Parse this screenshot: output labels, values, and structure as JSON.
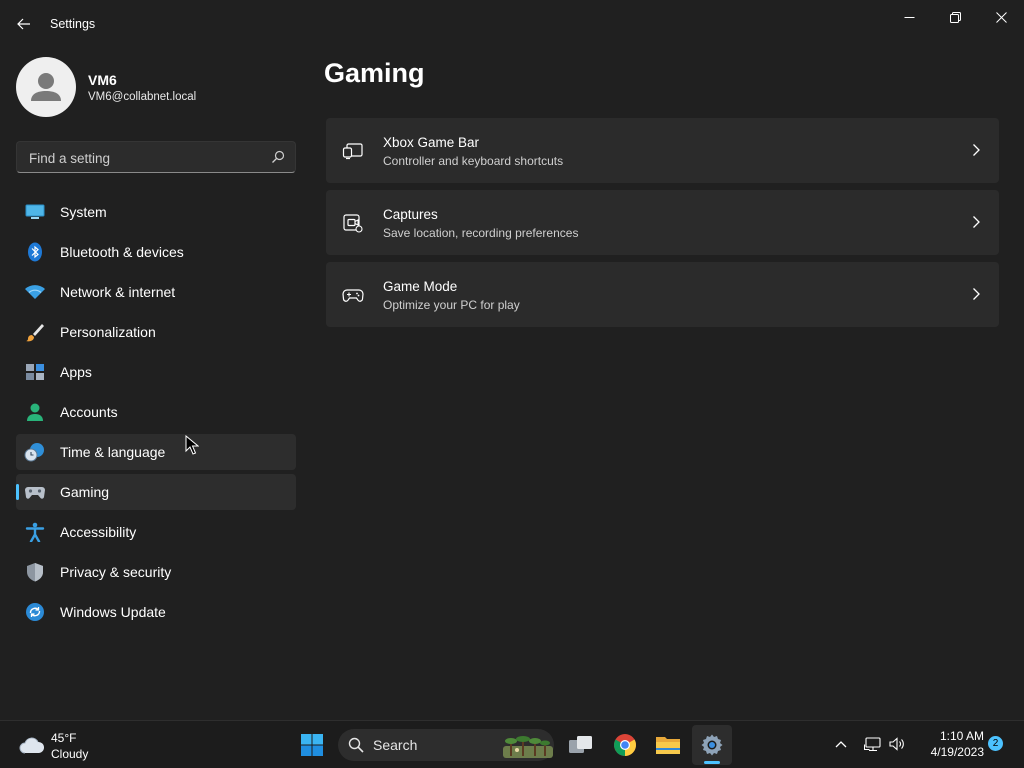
{
  "window": {
    "title": "Settings",
    "controls": {
      "minimize": "minimize",
      "maximize": "restore",
      "close": "close"
    }
  },
  "profile": {
    "name": "VM6",
    "email": "VM6@collabnet.local"
  },
  "search": {
    "placeholder": "Find a setting"
  },
  "nav": {
    "selected": "Gaming",
    "hovered": "Time & language",
    "items": [
      {
        "label": "System",
        "icon": "system-icon"
      },
      {
        "label": "Bluetooth & devices",
        "icon": "bluetooth-icon"
      },
      {
        "label": "Network & internet",
        "icon": "wifi-icon"
      },
      {
        "label": "Personalization",
        "icon": "paintbrush-icon"
      },
      {
        "label": "Apps",
        "icon": "apps-icon"
      },
      {
        "label": "Accounts",
        "icon": "person-icon"
      },
      {
        "label": "Time & language",
        "icon": "globe-clock-icon"
      },
      {
        "label": "Gaming",
        "icon": "gamepad-icon"
      },
      {
        "label": "Accessibility",
        "icon": "accessibility-icon"
      },
      {
        "label": "Privacy & security",
        "icon": "shield-icon"
      },
      {
        "label": "Windows Update",
        "icon": "update-icon"
      }
    ]
  },
  "main": {
    "title": "Gaming",
    "cards": [
      {
        "title": "Xbox Game Bar",
        "description": "Controller and keyboard shortcuts",
        "icon": "game-bar-icon"
      },
      {
        "title": "Captures",
        "description": "Save location, recording preferences",
        "icon": "capture-icon"
      },
      {
        "title": "Game Mode",
        "description": "Optimize your PC for play",
        "icon": "gamepad-icon"
      }
    ]
  },
  "taskbar": {
    "weather": {
      "temperature": "45°F",
      "condition": "Cloudy",
      "icon": "cloud-icon"
    },
    "search_label": "Search",
    "apps": [
      "start-icon",
      "task-view-icon",
      "chrome-icon",
      "file-explorer-icon",
      "settings-icon"
    ],
    "active_app": "Settings",
    "tray": [
      "chevron-up-icon",
      "network-icon",
      "volume-icon"
    ],
    "clock": {
      "time": "1:10 AM",
      "date": "4/19/2023"
    },
    "notification_count": "2"
  },
  "colors": {
    "background": "#202020",
    "card": "#2b2b2b",
    "accent": "#4cc2ff",
    "taskbar": "#1c1c1c"
  }
}
